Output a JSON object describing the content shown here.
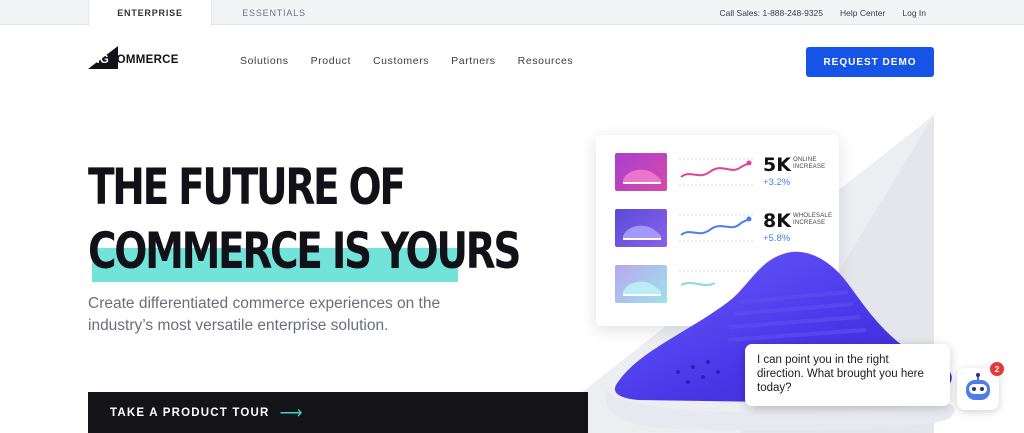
{
  "topbar": {
    "tabs": [
      "ENTERPRISE",
      "ESSENTIALS"
    ],
    "call_sales": "Call Sales: 1-888-248-9325",
    "help_center": "Help Center",
    "log_in": "Log In"
  },
  "logo": {
    "big": "BIG",
    "commerce": "COMMERCE"
  },
  "nav": [
    "Solutions",
    "Product",
    "Customers",
    "Partners",
    "Resources"
  ],
  "demo_button": "REQUEST DEMO",
  "hero": {
    "title_line1": "THE FUTURE OF",
    "title_line2": "COMMERCE IS YOURS",
    "subtitle": "Create differentiated commerce experiences on the industry’s most versatile enterprise solution."
  },
  "tour_button": "TAKE A PRODUCT TOUR",
  "stats": [
    {
      "value": "5K",
      "label_line1": "ONLINE",
      "label_line2": "INCREASE",
      "change": "+3.2%",
      "thumb_color": "#c23fb5",
      "line_color": "#e3429a"
    },
    {
      "value": "8K",
      "label_line1": "WHOLESALE",
      "label_line2": "INCREASE",
      "change": "+5.8%",
      "thumb_color": "#6a56e0",
      "line_color": "#4a7ef0"
    },
    {
      "value": "",
      "label_line1": "",
      "label_line2": "",
      "change": "",
      "thumb_color": "#9fd9e6",
      "line_color": "#8fd5e8"
    }
  ],
  "chat": {
    "message": "I can point you in the right direction. What brought you here today?",
    "badge_count": "2"
  },
  "colors": {
    "brand_blue": "#1654e8",
    "highlight_teal": "#72e3d9",
    "dark": "#121118"
  }
}
